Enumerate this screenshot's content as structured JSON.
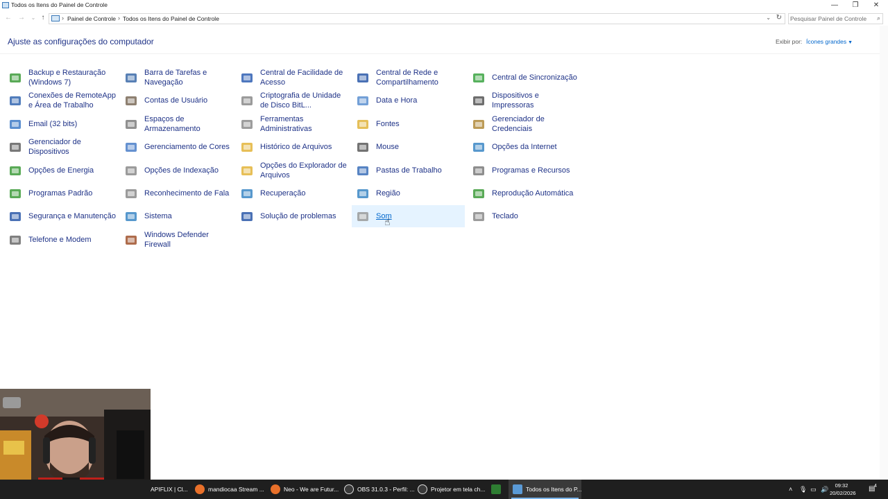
{
  "window": {
    "title": "Todos os Itens do Painel de Controle",
    "minimize_glyph": "—",
    "restore_glyph": "❐",
    "close_glyph": "✕"
  },
  "address": {
    "breadcrumbs": [
      "Painel de Controle",
      "Todos os Itens do Painel de Controle"
    ],
    "search_placeholder": "Pesquisar Painel de Controle"
  },
  "header": {
    "heading": "Ajuste as configurações do computador",
    "view_by_label": "Exibir por:",
    "view_by_value": "Ícones grandes"
  },
  "items": [
    {
      "label": "Backup e Restauração (Windows 7)",
      "icon": "backup-icon",
      "color": "#3d9b3a"
    },
    {
      "label": "Barra de Tarefas e Navegação",
      "icon": "taskbar-icon",
      "color": "#3b6aa8"
    },
    {
      "label": "Central de Facilidade de Acesso",
      "icon": "ease-of-access-icon",
      "color": "#2f5fb3"
    },
    {
      "label": "Central de Rede e Compartilhamento",
      "icon": "network-icon",
      "color": "#2a58a8"
    },
    {
      "label": "Central de Sincronização",
      "icon": "sync-icon",
      "color": "#3aa341"
    },
    {
      "label": "Conexões de RemoteApp e Área de Trabalho",
      "icon": "remoteapp-icon",
      "color": "#3266b0"
    },
    {
      "label": "Contas de Usuário",
      "icon": "user-accounts-icon",
      "color": "#7a6a58"
    },
    {
      "label": "Criptografia de Unidade de Disco BitL...",
      "icon": "bitlocker-icon",
      "color": "#8a8a8a"
    },
    {
      "label": "Data e Hora",
      "icon": "date-time-icon",
      "color": "#5a8fd0"
    },
    {
      "label": "Dispositivos e Impressoras",
      "icon": "printer-icon",
      "color": "#555555"
    },
    {
      "label": "Email (32 bits)",
      "icon": "mail-icon",
      "color": "#3d7ac7"
    },
    {
      "label": "Espaços de Armazenamento",
      "icon": "storage-spaces-icon",
      "color": "#7c7c7c"
    },
    {
      "label": "Ferramentas Administrativas",
      "icon": "admin-tools-icon",
      "color": "#8c8c8c"
    },
    {
      "label": "Fontes",
      "icon": "fonts-icon",
      "color": "#e0b43c"
    },
    {
      "label": "Gerenciador de Credenciais",
      "icon": "credential-manager-icon",
      "color": "#b08a3a"
    },
    {
      "label": "Gerenciador de Dispositivos",
      "icon": "device-manager-icon",
      "color": "#606060"
    },
    {
      "label": "Gerenciamento de Cores",
      "icon": "color-management-icon",
      "color": "#4a7ec8"
    },
    {
      "label": "Histórico de Arquivos",
      "icon": "file-history-icon",
      "color": "#e3b43a"
    },
    {
      "label": "Mouse",
      "icon": "mouse-icon",
      "color": "#5a5a5a"
    },
    {
      "label": "Opções da Internet",
      "icon": "internet-options-icon",
      "color": "#3a86c4"
    },
    {
      "label": "Opções de Energia",
      "icon": "power-icon",
      "color": "#3d9b3a"
    },
    {
      "label": "Opções de Indexação",
      "icon": "indexing-icon",
      "color": "#8a8a8a"
    },
    {
      "label": "Opções do Explorador de Arquivos",
      "icon": "folder-options-icon",
      "color": "#e3b43a"
    },
    {
      "label": "Pastas de Trabalho",
      "icon": "work-folders-icon",
      "color": "#3a6fb8"
    },
    {
      "label": "Programas e Recursos",
      "icon": "programs-icon",
      "color": "#7a7a7a"
    },
    {
      "label": "Programas Padrão",
      "icon": "default-programs-icon",
      "color": "#3d9b3a"
    },
    {
      "label": "Reconhecimento de Fala",
      "icon": "microphone-icon",
      "color": "#8a8a8a"
    },
    {
      "label": "Recuperação",
      "icon": "recovery-icon",
      "color": "#3a86c4"
    },
    {
      "label": "Região",
      "icon": "region-icon",
      "color": "#3a86c4"
    },
    {
      "label": "Reprodução Automática",
      "icon": "autoplay-icon",
      "color": "#3d9b3a"
    },
    {
      "label": "Segurança e Manutenção",
      "icon": "security-flag-icon",
      "color": "#2a58a8"
    },
    {
      "label": "Sistema",
      "icon": "system-icon",
      "color": "#3a86c4"
    },
    {
      "label": "Solução de problemas",
      "icon": "troubleshooting-icon",
      "color": "#2a58a8"
    },
    {
      "label": "Som",
      "icon": "speaker-icon",
      "color": "#9a9a9a"
    },
    {
      "label": "Teclado",
      "icon": "keyboard-icon",
      "color": "#8a8a8a"
    },
    {
      "label": "Telefone e Modem",
      "icon": "phone-modem-icon",
      "color": "#6a6a6a"
    },
    {
      "label": "Windows Defender Firewall",
      "icon": "firewall-icon",
      "color": "#a0522d"
    }
  ],
  "hovered_item": "Som",
  "taskbar": {
    "apps": [
      {
        "label": "APIFLIX | Cl...",
        "icon": "folder-icon",
        "color": "#e3b43a"
      },
      {
        "label": "mandiocaa Stream ...",
        "icon": "firefox-icon",
        "color": "#e8702a"
      },
      {
        "label": "Neo - We are Futur...",
        "icon": "firefox-icon",
        "color": "#e8702a"
      },
      {
        "label": "OBS 31.0.3 - Perfil: ...",
        "icon": "obs-icon",
        "color": "#3a3a3a"
      },
      {
        "label": "Projetor em tela ch...",
        "icon": "obs-icon",
        "color": "#3a3a3a"
      },
      {
        "label": "",
        "icon": "notepad-icon",
        "color": "#2e7d32"
      },
      {
        "label": "Todos os Itens do P...",
        "icon": "control-panel-icon",
        "color": "#5a9ad6"
      }
    ],
    "time": "09:32",
    "date": "20/02/2026",
    "notification_count": "4"
  }
}
